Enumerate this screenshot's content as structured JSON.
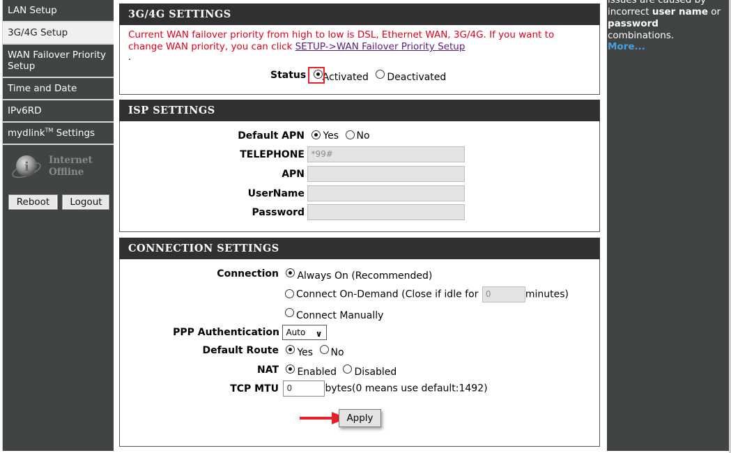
{
  "sidebar": {
    "items": [
      {
        "label": "LAN Setup",
        "active": false
      },
      {
        "label": "3G/4G Setup",
        "active": true
      },
      {
        "label": "WAN Failover Priority Setup",
        "active": false
      },
      {
        "label": "Time and Date",
        "active": false
      },
      {
        "label": "IPv6RD",
        "active": false
      },
      {
        "label_main": "mydlink",
        "label_sup": "TM",
        "label_tail": " Settings",
        "active": false
      }
    ],
    "internet_status_line1": "Internet",
    "internet_status_line2": "Offline",
    "reboot_label": "Reboot",
    "logout_label": "Logout"
  },
  "settings_3g4g": {
    "title": "3G/4G SETTINGS",
    "notice_text": "Current WAN failover priority from high to low is DSL, Ethernet WAN, 3G/4G. If you want to change WAN priority, you can click ",
    "notice_link": "SETUP->WAN Failover Priority Setup",
    "notice_tail": ".",
    "status_label": "Status",
    "status_options": [
      "Activated",
      "Deactivated"
    ],
    "status_selected": "Activated"
  },
  "isp": {
    "title": "ISP SETTINGS",
    "default_apn_label": "Default APN",
    "default_apn_options": [
      "Yes",
      "No"
    ],
    "default_apn_selected": "Yes",
    "telephone_label": "TELEPHONE",
    "telephone_value": "*99#",
    "apn_label": "APN",
    "apn_value": "",
    "username_label": "UserName",
    "username_value": "",
    "password_label": "Password",
    "password_value": ""
  },
  "connection": {
    "title": "CONNECTION SETTINGS",
    "connection_label": "Connection",
    "options": {
      "always_on": "Always On (Recommended)",
      "on_demand_prefix": "Connect On-Demand (Close if idle for",
      "on_demand_value": "0",
      "on_demand_suffix": "minutes)",
      "manual": "Connect Manually"
    },
    "connection_selected": "Always On (Recommended)",
    "ppp_auth_label": "PPP Authentication",
    "ppp_auth_value": "Auto",
    "default_route_label": "Default Route",
    "default_route_options": [
      "Yes",
      "No"
    ],
    "default_route_selected": "Yes",
    "nat_label": "NAT",
    "nat_options": [
      "Enabled",
      "Disabled"
    ],
    "nat_selected": "Enabled",
    "tcp_mtu_label": "TCP MTU",
    "tcp_mtu_value": "0",
    "tcp_mtu_hint": "bytes(0 means use default:1492)",
    "apply_label": "Apply"
  },
  "help": {
    "line1": "issues are caused by",
    "line2_a": "incorrect ",
    "line2_b": "user name",
    "line2_c": " or",
    "line3_a": "password",
    "line3_b": " combinations.",
    "more_label": "More..."
  },
  "annotation_color": "#e8202a"
}
